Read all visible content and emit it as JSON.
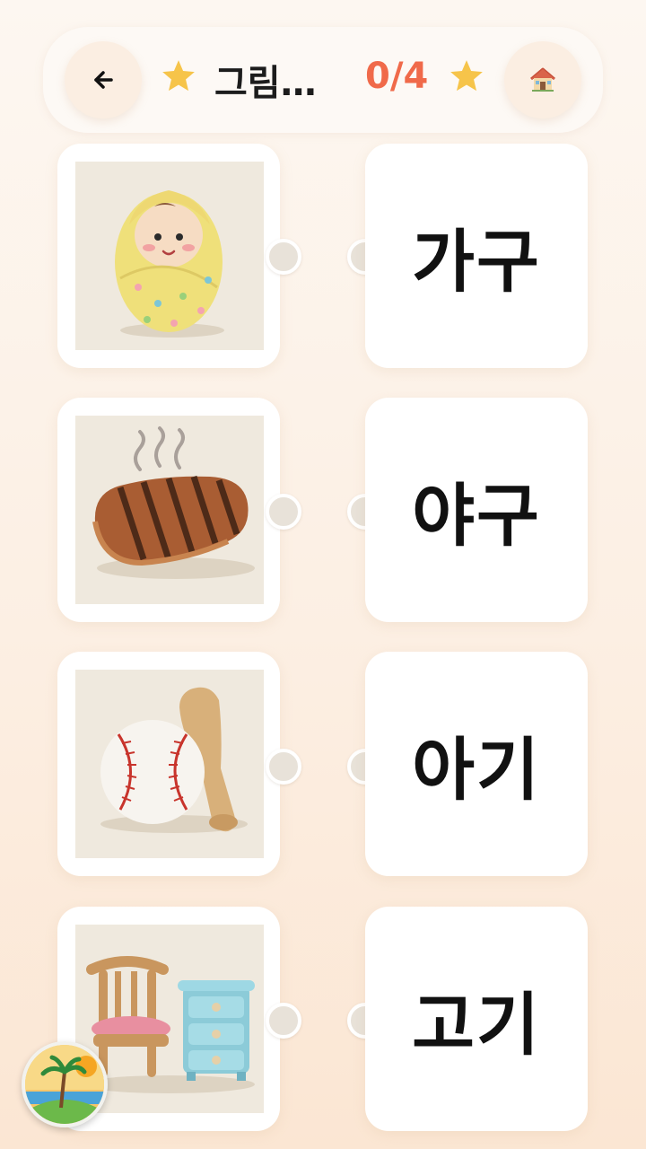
{
  "header": {
    "title": "그림…",
    "progress": "0/4",
    "back_icon": "arrow-left-icon",
    "home_icon": "house-icon",
    "star_color": "#f6c44a",
    "progress_color": "#f06a4a"
  },
  "pictures": [
    {
      "name": "swaddled-baby-image",
      "icon": "baby-icon"
    },
    {
      "name": "grilled-meat-image",
      "icon": "meat-icon"
    },
    {
      "name": "baseball-bat-image",
      "icon": "baseball-icon"
    },
    {
      "name": "chair-drawer-image",
      "icon": "furniture-icon"
    }
  ],
  "words": [
    {
      "label": "가구"
    },
    {
      "label": "야구"
    },
    {
      "label": "아기"
    },
    {
      "label": "고기"
    }
  ],
  "logo": {
    "icon": "island-logo-icon"
  }
}
